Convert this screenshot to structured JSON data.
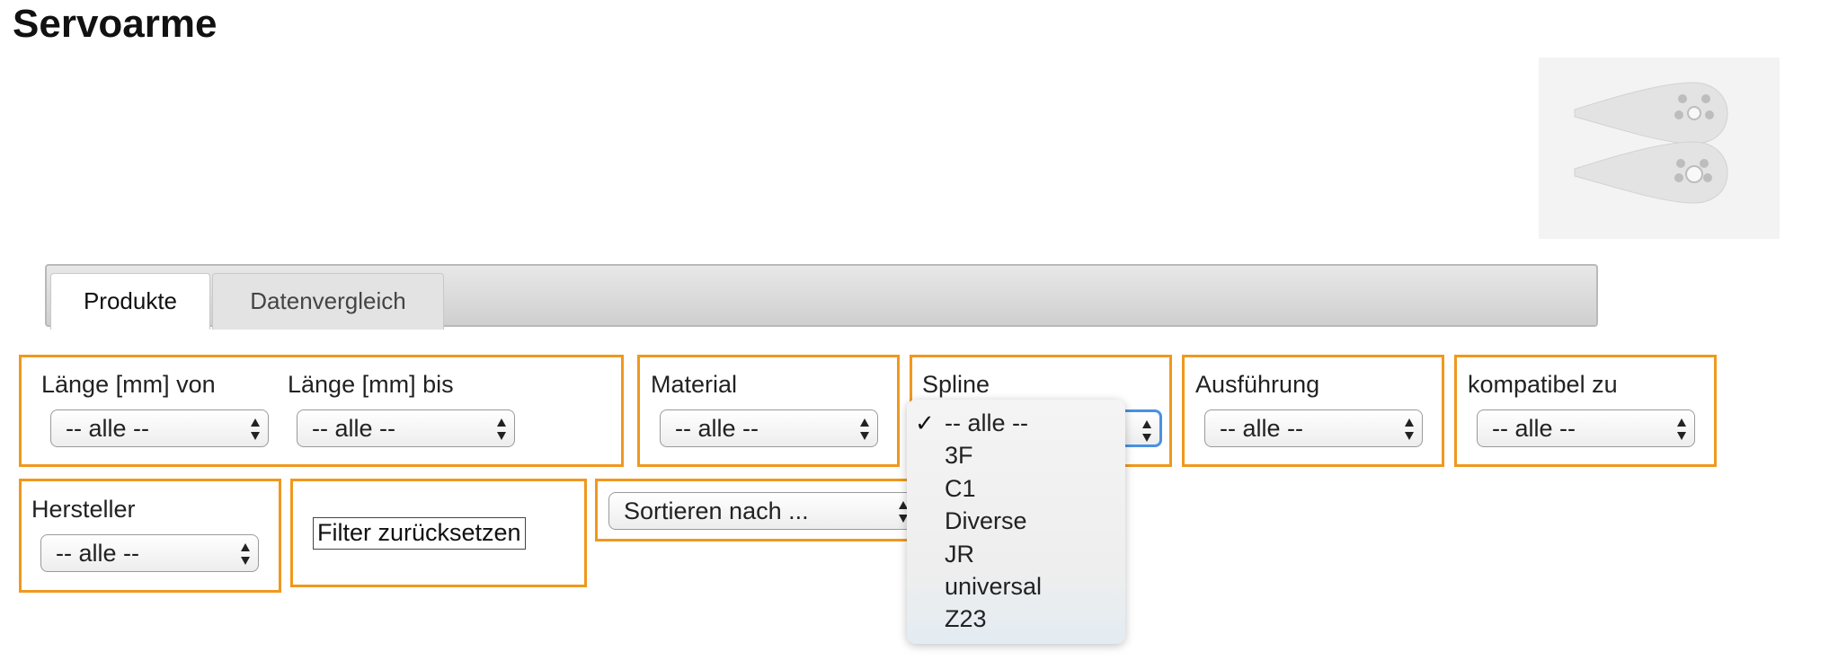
{
  "page": {
    "title": "Servoarme"
  },
  "tabs": [
    {
      "label": "Produkte",
      "active": true
    },
    {
      "label": "Datenvergleich",
      "active": false
    }
  ],
  "filters": {
    "laenge_von": {
      "label": "Länge [mm] von",
      "value": "-- alle --"
    },
    "laenge_bis": {
      "label": "Länge [mm] bis",
      "value": "-- alle --"
    },
    "material": {
      "label": "Material",
      "value": "-- alle --"
    },
    "spline": {
      "label": "Spline",
      "value": "-- alle --",
      "options": [
        "-- alle --",
        "3F",
        "C1",
        "Diverse",
        "JR",
        "universal",
        "Z23"
      ]
    },
    "ausfuehrung": {
      "label": "Ausführung",
      "value": "-- alle --"
    },
    "kompatibel": {
      "label": "kompatibel zu",
      "value": "-- alle --"
    },
    "hersteller": {
      "label": "Hersteller",
      "value": "-- alle --"
    },
    "reset_label": "Filter zurücksetzen",
    "sort_value": "Sortieren nach ..."
  },
  "colors": {
    "accent": "#f0981e",
    "focus": "#4a90e2"
  },
  "icons": {
    "select_arrows": "updown-arrows-icon",
    "checkmark": "checkmark-icon"
  }
}
